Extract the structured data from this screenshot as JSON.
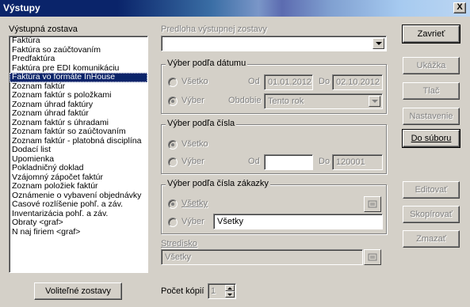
{
  "window": {
    "title": "Výstupy",
    "close_glyph": "X"
  },
  "report_list": {
    "label": "Výstupná zostava",
    "items": [
      "Faktúra",
      "Faktúra so zaúčtovaním",
      "Predfaktúra",
      "Faktúra pre EDI komunikáciu",
      "Faktúra vo formáte InHouse",
      "Zoznam faktúr",
      "Zoznam faktúr s položkami",
      "Zoznam úhrad faktúry",
      "Zoznam úhrad faktúr",
      "Zoznam faktúr s úhradami",
      "Zoznam faktúr so zaúčtovaním",
      "Zoznam faktúr - platobná disciplína",
      "Dodací list",
      "Upomienka",
      "Pokladničný doklad",
      "Vzájomný zápočet faktúr",
      "Zoznam položiek faktúr",
      "Oznámenie o vybavení objednávky",
      "Časové rozlíšenie pohľ. a záv.",
      "Inventarizácia pohľ. a záv.",
      "Obraty <graf>",
      "N naj firiem  <graf>"
    ],
    "selected_index": 4
  },
  "optional_reports_button": "Voliteľné zostavy",
  "template": {
    "label": "Predloha výstupnej zostavy",
    "value": ""
  },
  "date_group": {
    "title": "Výber podľa dátumu",
    "all_label": "Všetko",
    "selection_label": "Výber",
    "from_label": "Od",
    "from_value": "01.01.2012",
    "to_label": "Do",
    "to_value": "02.10.2012",
    "period_label": "Obdobie",
    "period_value": "Tento rok"
  },
  "number_group": {
    "title": "Výber podľa čísla",
    "all_label": "Všetko",
    "selection_label": "Výber",
    "from_label": "Od",
    "from_value": "",
    "to_label": "Do",
    "to_value": "120001"
  },
  "order_group": {
    "title": "Výber podľa čísla zákazky",
    "all_label": "Všetky",
    "selection_label": "Výber",
    "selection_value": "Všetky"
  },
  "center": {
    "label": "Stredisko",
    "value": "Všetky"
  },
  "copies": {
    "label": "Počet kópií",
    "value": "1"
  },
  "buttons": {
    "close": "Zavrieť",
    "preview": "Ukážka",
    "print": "Tlač",
    "settings": "Nastavenie",
    "to_file": "Do súboru",
    "edit": "Editovať",
    "copy": "Skopírovať",
    "delete": "Zmazať"
  }
}
